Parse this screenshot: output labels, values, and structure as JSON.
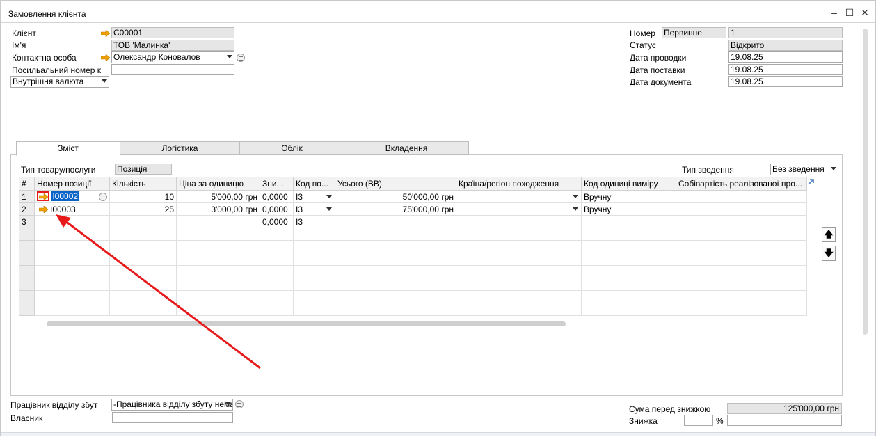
{
  "window": {
    "title": "Замовлення клієнта"
  },
  "header_left": {
    "client_label": "Клієнт",
    "client_value": "C00001",
    "name_label": "Ім'я",
    "name_value": "ТОВ 'Малинка'",
    "contact_label": "Контактна особа",
    "contact_value": "Олександр Коновалов",
    "ref_label": "Посильальний номер к",
    "ref_value": "",
    "currency_value": "Внутрішня валюта"
  },
  "header_right": {
    "number_label": "Номер",
    "number_series": "Первинне",
    "number_value": "1",
    "status_label": "Статус",
    "status_value": "Відкрито",
    "posting_date_label": "Дата проводки",
    "posting_date_value": "19.08.25",
    "delivery_date_label": "Дата поставки",
    "delivery_date_value": "19.08.25",
    "doc_date_label": "Дата документа",
    "doc_date_value": "19.08.25"
  },
  "tabs": [
    {
      "label": "Зміст"
    },
    {
      "label": "Логістика"
    },
    {
      "label": "Облік"
    },
    {
      "label": "Вкладення"
    }
  ],
  "contents": {
    "item_type_label": "Тип товару/послуги",
    "item_type_value": "Позиція",
    "summary_type_label": "Тип зведення",
    "summary_type_value": "Без зведення"
  },
  "grid": {
    "columns": [
      "#",
      "Номер позиції",
      "Кількість",
      "Ціна за одиницю",
      "Зни...",
      "Код по...",
      "Усього (ВВ)",
      "Країна/регіон походження",
      "Код одиниці виміру",
      "Собівартість реалізованої про..."
    ],
    "rows": [
      {
        "n": "1",
        "item": "I00002",
        "qty": "10",
        "price": "5'000,00 грн",
        "disc": "0,0000",
        "tax": "I3",
        "total": "50'000,00 грн",
        "country": "",
        "uom": "Вручну",
        "cost": ""
      },
      {
        "n": "2",
        "item": "I00003",
        "qty": "25",
        "price": "3'000,00 грн",
        "disc": "0,0000",
        "tax": "I3",
        "total": "75'000,00 грн",
        "country": "",
        "uom": "Вручну",
        "cost": ""
      },
      {
        "n": "3",
        "item": "",
        "qty": "",
        "price": "",
        "disc": "0,0000",
        "tax": "I3",
        "total": "",
        "country": "",
        "uom": "",
        "cost": ""
      }
    ]
  },
  "footer": {
    "sales_employee_label": "Працівник відділу збут",
    "sales_employee_value": "-Працівника відділу збуту немає-",
    "owner_label": "Власник",
    "owner_value": "",
    "total_before_disc_label": "Сума перед знижкою",
    "total_before_disc_value": "125'000,00 грн",
    "discount_label": "Знижка",
    "discount_pct": "",
    "discount_pct_sign": "%",
    "discount_value": ""
  },
  "colors": {
    "link_arrow": "#f0a000",
    "annotation": "#e8191a",
    "selection": "#0a64c8"
  },
  "icons": [
    "link-arrow-icon",
    "dropdown-icon",
    "details-icon",
    "move-up-icon",
    "move-down-icon",
    "expand-icon"
  ]
}
